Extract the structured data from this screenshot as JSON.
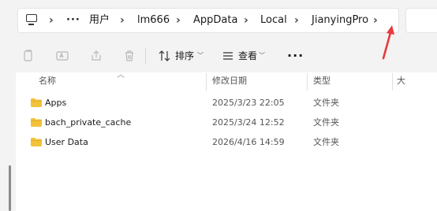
{
  "breadcrumb": {
    "overflow": "···",
    "items": [
      "用户",
      "lm666",
      "AppData",
      "Local",
      "JianyingPro"
    ]
  },
  "toolbar": {
    "sort_label": "排序",
    "view_label": "查看",
    "more_label": "···"
  },
  "columns": {
    "name": "名称",
    "date": "修改日期",
    "type": "类型",
    "size": "大"
  },
  "rows": [
    {
      "name": "Apps",
      "date": "2025/3/23 22:05",
      "type": "文件夹"
    },
    {
      "name": "bach_private_cache",
      "date": "2025/3/24 12:52",
      "type": "文件夹"
    },
    {
      "name": "User Data",
      "date": "2026/4/16 14:59",
      "type": "文件夹"
    }
  ],
  "colors": {
    "folder": "#f2c23b",
    "annotation_arrow": "#e8393c"
  }
}
